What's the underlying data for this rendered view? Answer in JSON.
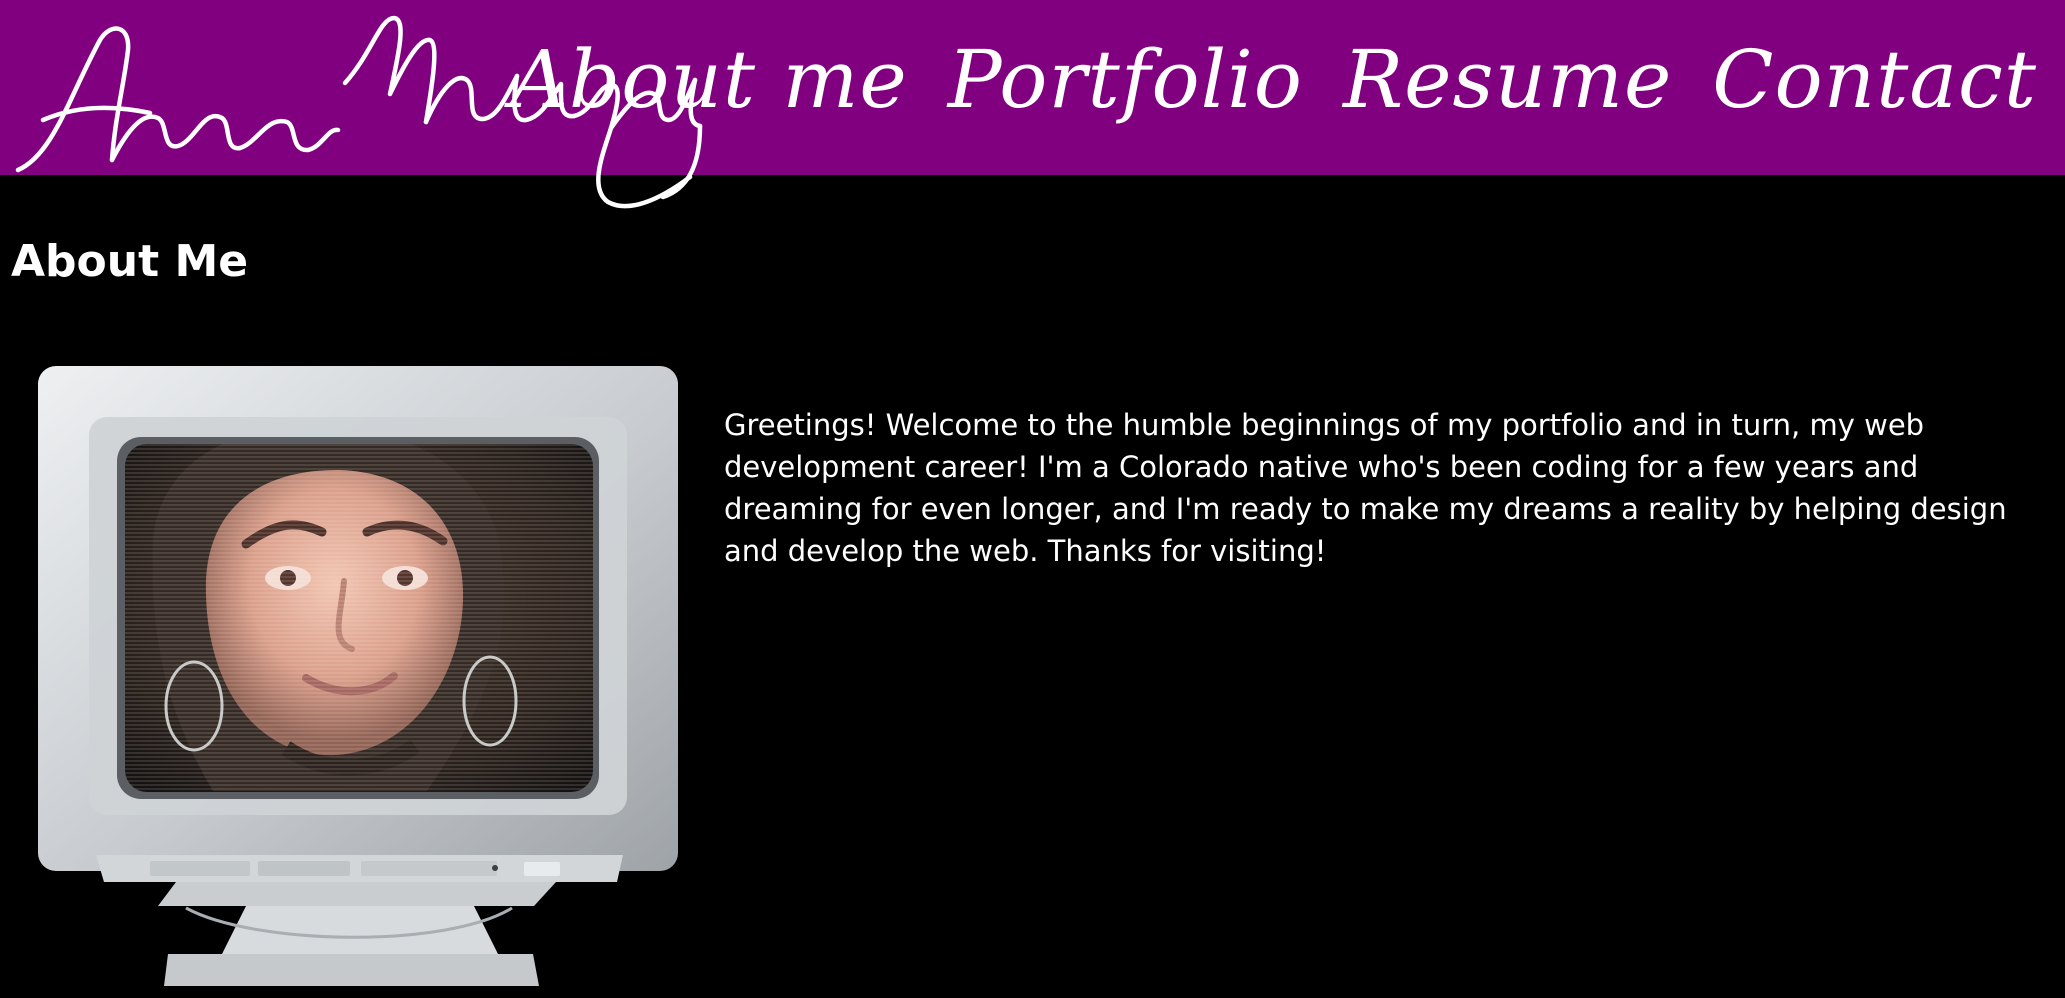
{
  "header": {
    "brand_color": "#800080",
    "logo_text": "Anna Murphy"
  },
  "nav": {
    "items": [
      {
        "label": "About me"
      },
      {
        "label": "Portfolio"
      },
      {
        "label": "Resume"
      },
      {
        "label": "Contact"
      }
    ]
  },
  "main": {
    "title": "About Me",
    "bio": "Greetings! Welcome to the humble beginnings of my portfolio and in turn, my web development career! I'm a Colorado native who's been coding for a few years and dreaming for even longer, and I'm ready to make my dreams a reality by helping design and develop the web. Thanks for visiting!"
  },
  "colors": {
    "page_bg": "#000000",
    "header_bg": "#800080",
    "text": "#ffffff"
  },
  "icons": {
    "profile_image": "computer-monitor-portrait-icon"
  }
}
